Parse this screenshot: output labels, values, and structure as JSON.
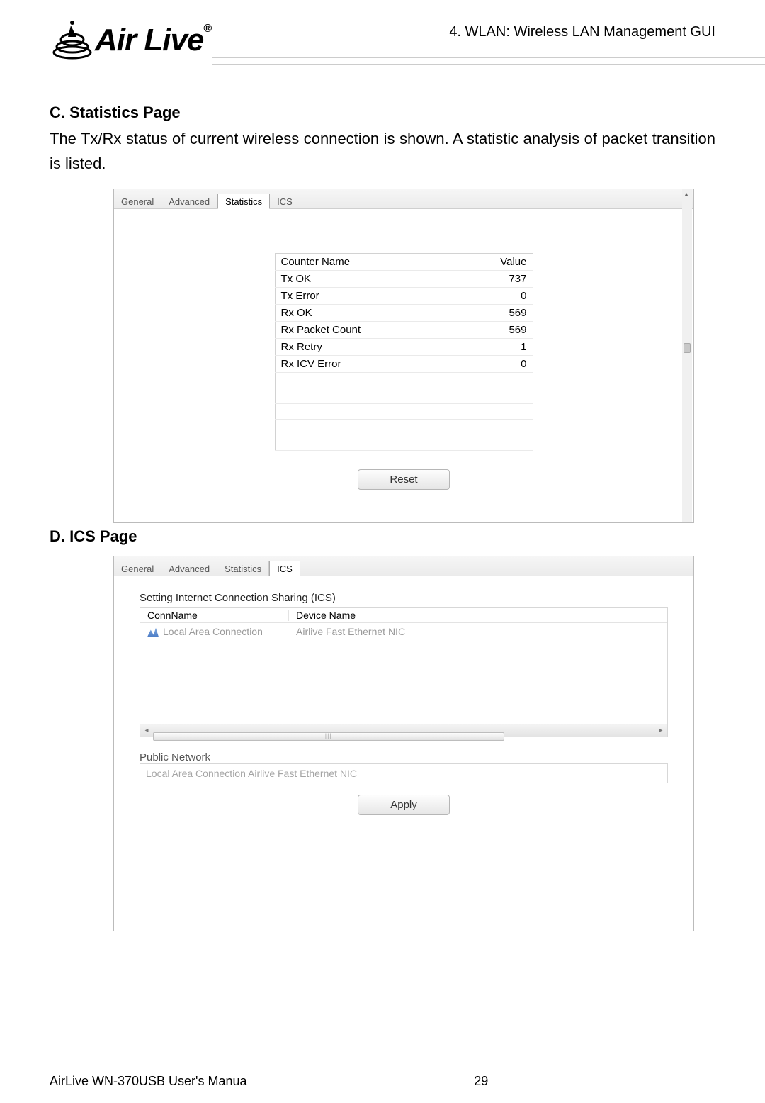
{
  "header": {
    "breadcrumb": "4. WLAN: Wireless LAN Management GUI"
  },
  "logo": {
    "brand": "Air Live",
    "reg": "®"
  },
  "sectionC": {
    "title": "C. Statistics Page",
    "body": "The Tx/Rx status of current wireless connection is shown. A statistic analysis of packet transition is listed."
  },
  "sectionD": {
    "title": "D. ICS Page"
  },
  "tabs": {
    "general": "General",
    "advanced": "Advanced",
    "statistics": "Statistics",
    "ics": "ICS"
  },
  "stats": {
    "headers": {
      "name": "Counter Name",
      "value": "Value"
    },
    "rows": [
      {
        "name": "Tx OK",
        "value": "737"
      },
      {
        "name": "Tx Error",
        "value": "0"
      },
      {
        "name": "Rx OK",
        "value": "569"
      },
      {
        "name": "Rx Packet Count",
        "value": "569"
      },
      {
        "name": "Rx Retry",
        "value": "1"
      },
      {
        "name": "Rx ICV Error",
        "value": "0"
      }
    ],
    "reset_label": "Reset"
  },
  "ics": {
    "group_label": "Setting Internet Connection Sharing (ICS)",
    "headers": {
      "conn": "ConnName",
      "dev": "Device Name"
    },
    "row": {
      "conn": "Local Area Connection",
      "dev": "Airlive Fast Ethernet NIC"
    },
    "public_label": "Public Network",
    "public_value": "Local Area Connection Airlive Fast Ethernet NIC",
    "apply_label": "Apply"
  },
  "footer": {
    "left": "AirLive WN-370USB User's Manua",
    "page": "29"
  }
}
